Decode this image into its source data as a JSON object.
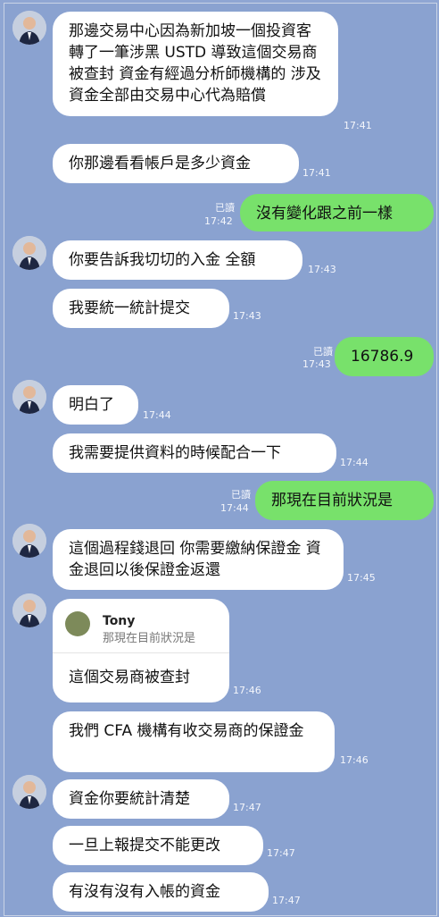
{
  "colors": {
    "background": "#8aa2d0",
    "incoming": "#ffffff",
    "outgoing": "#78e16b"
  },
  "messages": [
    {
      "text": "那邊交易中心因為新加坡一個投資客 轉了一筆涉黑 USTD 導致這個交易商被查封 資金有經過分析師機構的 涉及資金全部由交易中心代為賠償",
      "time": "17:41"
    },
    {
      "text": "你那邊看看帳戶是多少資金",
      "time": "17:41"
    },
    {
      "text": "沒有變化跟之前一樣",
      "time": "17:42",
      "read": "已讀"
    },
    {
      "text": "你要告訴我切切的入金 全額",
      "time": "17:43"
    },
    {
      "text": "我要統一統計提交",
      "time": "17:43"
    },
    {
      "text": "16786.9",
      "time": "17:43",
      "read": "已讀"
    },
    {
      "text": "明白了",
      "time": "17:44"
    },
    {
      "text": "我需要提供資料的時候配合一下",
      "time": "17:44"
    },
    {
      "text": "那現在目前狀況是",
      "time": "17:44",
      "read": "已讀"
    },
    {
      "text": "這個過程錢退回 你需要繳納保證金 資金退回以後保證金返還",
      "time": "17:45"
    },
    {
      "quote_name": "Tony",
      "quote_text": "那現在目前狀況是",
      "text": "這個交易商被查封",
      "time": "17:46"
    },
    {
      "text": "我們 CFA 機構有收交易商的保證金",
      "time": "17:46"
    },
    {
      "text": "資金你要統計清楚",
      "time": "17:47"
    },
    {
      "text": "一旦上報提交不能更改",
      "time": "17:47"
    },
    {
      "text": "有沒有沒有入帳的資金",
      "time": "17:47"
    }
  ]
}
